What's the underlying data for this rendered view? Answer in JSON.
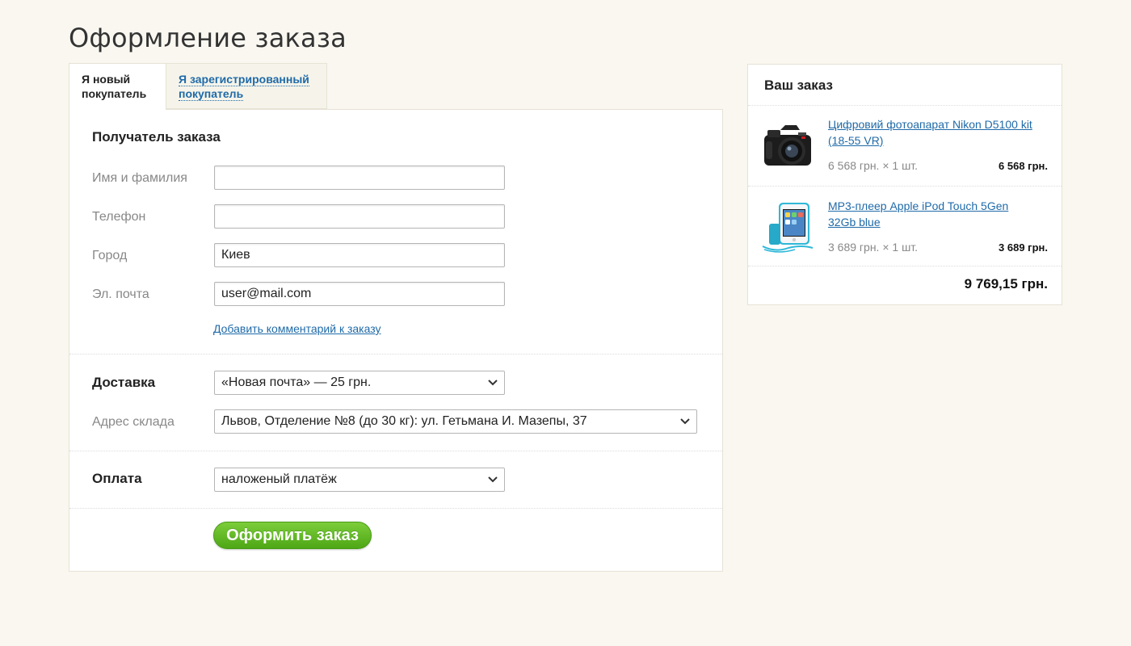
{
  "page": {
    "title": "Оформление заказа"
  },
  "tabs": [
    {
      "label": "Я новый покупатель",
      "active": true
    },
    {
      "label": "Я зарегистрированный покупатель",
      "active": false
    }
  ],
  "recipient": {
    "heading": "Получатель заказа",
    "name": {
      "label": "Имя и фамилия",
      "value": ""
    },
    "phone": {
      "label": "Телефон",
      "value": ""
    },
    "city": {
      "label": "Город",
      "value": "Киев"
    },
    "email": {
      "label": "Эл. почта",
      "value": "user@mail.com"
    },
    "comment_link": "Добавить комментарий к заказу"
  },
  "delivery": {
    "heading": "Доставка",
    "method": "«Новая почта» — 25 грн.",
    "warehouse_label": "Адрес склада",
    "warehouse": "Львов, Отделение №8 (до 30 кг): ул. Гетьмана И. Мазепы, 37"
  },
  "payment": {
    "heading": "Оплата",
    "method": "наложеный платёж"
  },
  "submit_label": "Оформить заказ",
  "order": {
    "title": "Ваш заказ",
    "items": [
      {
        "name": "Цифровий фотоапарат Nikon D5100 kit (18-55 VR)",
        "qty_line": "6 568 грн. × 1 шт.",
        "sum": "6 568 грн.",
        "image_icon": "camera-icon"
      },
      {
        "name": "MP3-плеер Apple iPod Touch 5Gen 32Gb blue",
        "qty_line": "3 689 грн. × 1 шт.",
        "sum": "3 689 грн.",
        "image_icon": "music-player-icon"
      }
    ],
    "total": "9 769,15 грн."
  },
  "colors": {
    "accent_link": "#1f6aa8",
    "button_green": "#5ab520",
    "background": "#f9f7f0"
  }
}
